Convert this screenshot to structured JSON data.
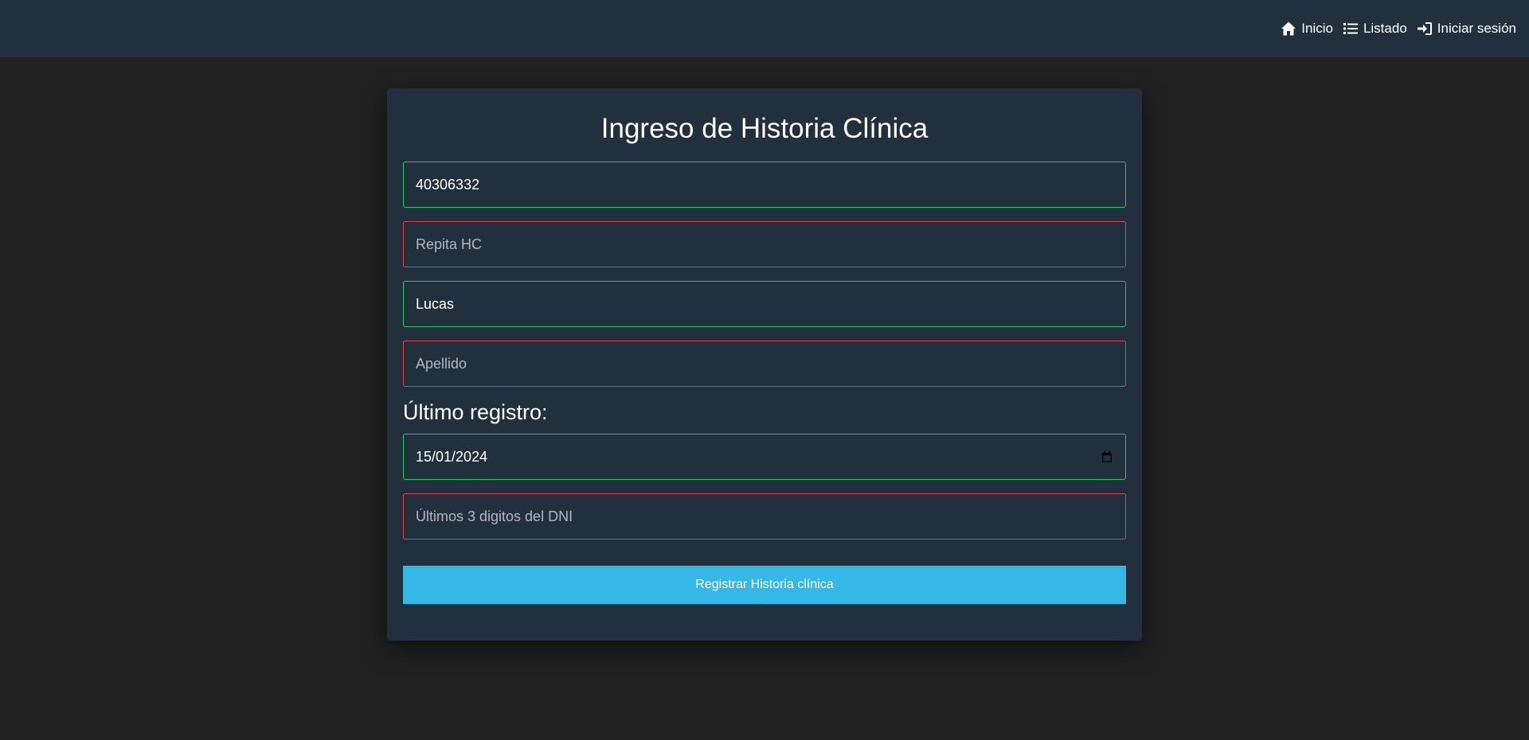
{
  "navbar": {
    "links": [
      {
        "label": "Inicio",
        "icon": "home-icon"
      },
      {
        "label": "Listado",
        "icon": "list-icon"
      },
      {
        "label": "Iniciar sesión",
        "icon": "sign-in-icon"
      }
    ]
  },
  "form": {
    "title": "Ingreso de Historia Clínica",
    "hc": {
      "value": "40306332",
      "placeholder": ""
    },
    "repeat_hc": {
      "value": "",
      "placeholder": "Repita HC"
    },
    "nombre": {
      "value": "Lucas",
      "placeholder": ""
    },
    "apellido": {
      "value": "",
      "placeholder": "Apellido"
    },
    "last_record_label": "Último registro:",
    "fecha": {
      "value": "15/01/2024"
    },
    "dni": {
      "value": "",
      "placeholder": "Últimos 3 digitos del DNI"
    },
    "submit_label": "Registrar Historia clínica"
  },
  "colors": {
    "navbar_bg": "#222f3d",
    "page_bg": "#212121",
    "valid_border": "#29c266",
    "invalid_border": "#e0424c",
    "button_bg": "#35b8e6"
  }
}
